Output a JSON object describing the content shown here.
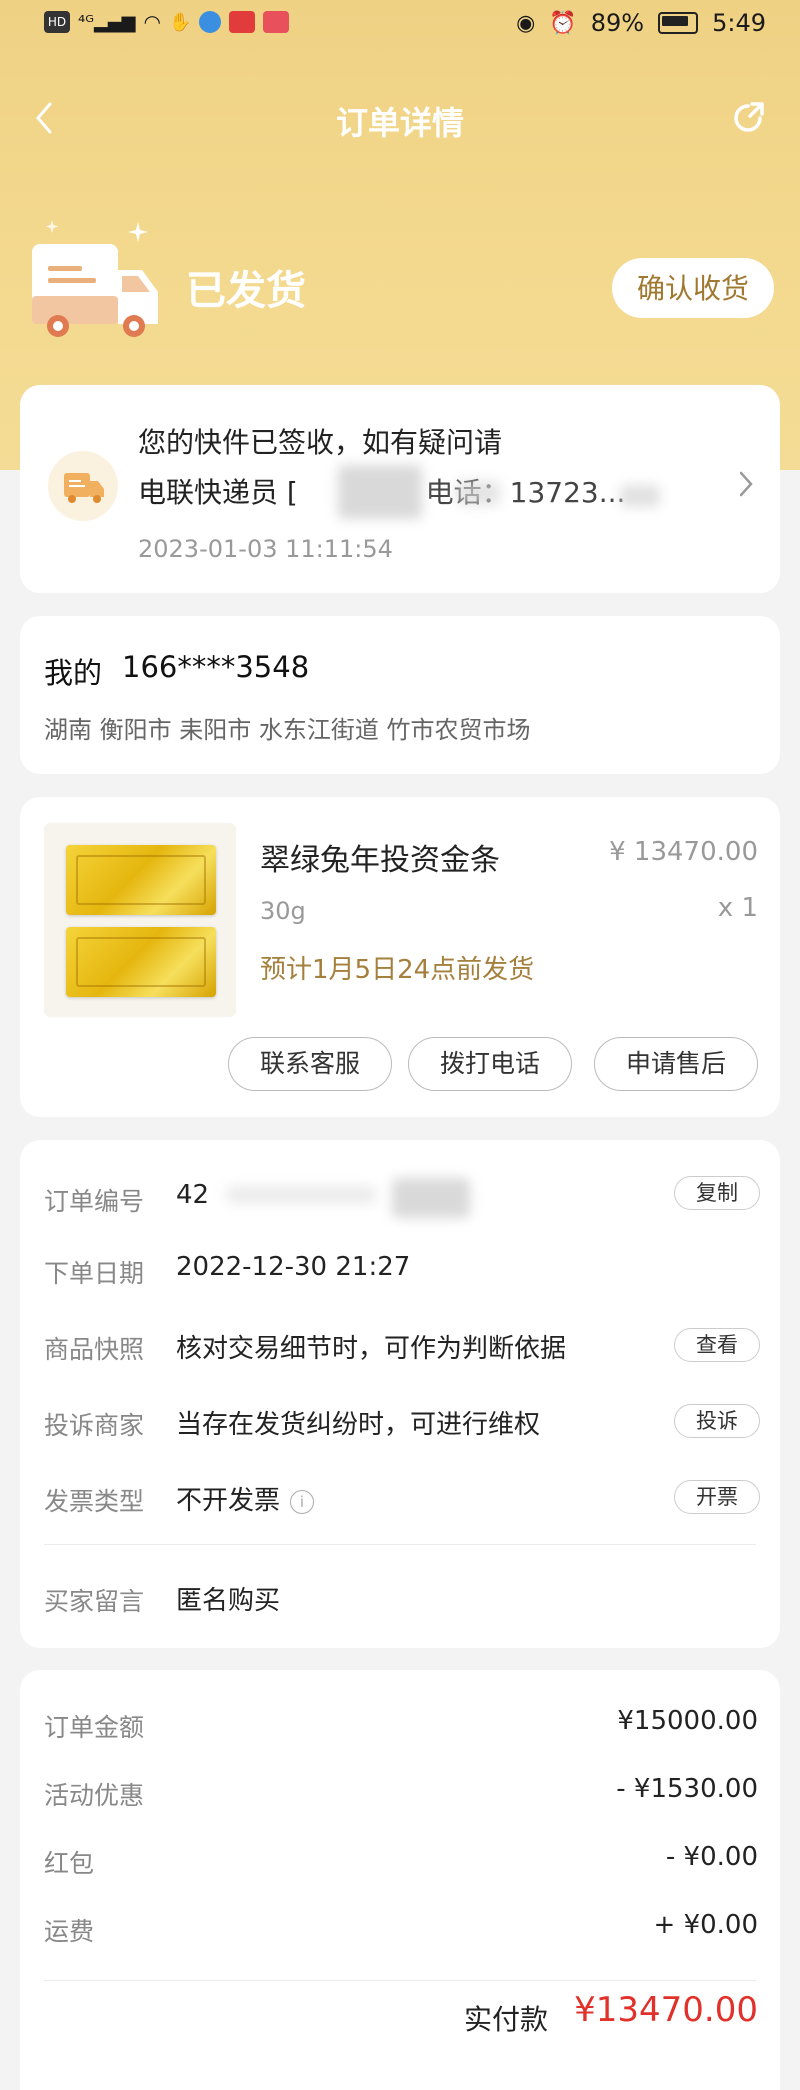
{
  "status_bar": {
    "left_icons": [
      "hd-icon",
      "4g-signal-icon",
      "wifi-icon",
      "hand-icon",
      "app-badge-icon",
      "app-badge-icon",
      "app-badge-icon"
    ],
    "battery": "89%",
    "time": "5:49"
  },
  "header": {
    "title": "订单详情",
    "back_icon": "chevron-left-icon",
    "share_icon": "share-icon"
  },
  "order_status": {
    "title": "已发货",
    "confirm_label": "确认收货",
    "icon": "delivery-truck-icon"
  },
  "logistics": {
    "line1": "您的快件已签收，如有疑问请",
    "line2": "电联快递员 [",
    "line2_phone": "电话：13723...",
    "time": "2023-01-03 11:11:54"
  },
  "address": {
    "name": "我的",
    "phone": "166****3548",
    "detail": "湖南 衡阳市 耒阳市 水东江街道 竹市农贸市场"
  },
  "product": {
    "name": "翠绿兔年投资金条",
    "price": "¥ 13470.00",
    "spec": "30g",
    "qty": "x 1",
    "ship_note": "预计1月5日24点前发货",
    "buttons": [
      "联系客服",
      "拨打电话",
      "申请售后"
    ]
  },
  "order_info": {
    "rows": [
      {
        "label": "订单编号",
        "value": "42",
        "action": "复制"
      },
      {
        "label": "下单日期",
        "value": "2022-12-30 21:27"
      },
      {
        "label": "商品快照",
        "value": "核对交易细节时，可作为判断依据",
        "action": "查看"
      },
      {
        "label": "投诉商家",
        "value": "当存在发货纠纷时，可进行维权",
        "action": "投诉"
      },
      {
        "label": "发票类型",
        "value": "不开发票",
        "action": "开票"
      }
    ],
    "note_label": "买家留言",
    "note_value": "匿名购买"
  },
  "amounts": {
    "rows": [
      {
        "label": "订单金额",
        "value": "¥15000.00"
      },
      {
        "label": "活动优惠",
        "value": "- ¥1530.00"
      },
      {
        "label": "红包",
        "value": "- ¥0.00"
      },
      {
        "label": "运费",
        "value": "+ ¥0.00"
      }
    ],
    "total_label": "实付款",
    "total_value": "¥13470.00"
  },
  "colors": {
    "header_gold": "#efd184",
    "accent_brown": "#a57f3c",
    "price_red": "#e0312b"
  }
}
